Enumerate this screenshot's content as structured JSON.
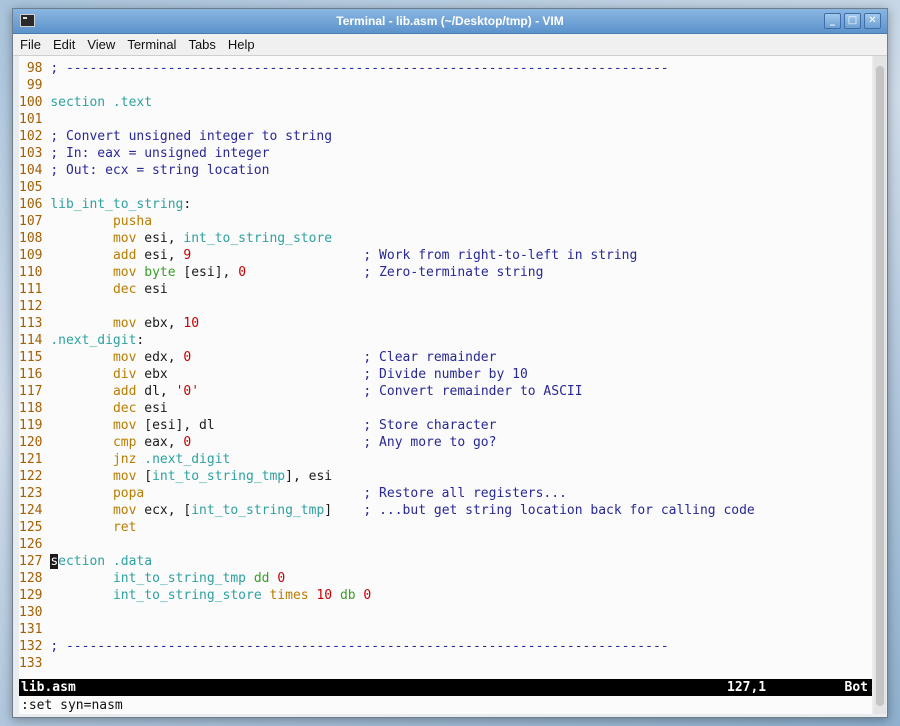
{
  "window": {
    "title": "Terminal - lib.asm (~/Desktop/tmp) - VIM",
    "buttons": {
      "minimize": "_",
      "maximize": "□",
      "close": "✕"
    }
  },
  "menu": [
    "File",
    "Edit",
    "View",
    "Terminal",
    "Tabs",
    "Help"
  ],
  "editor": {
    "lines": [
      [
        [
          "ln",
          " 98 "
        ],
        [
          "cm",
          "; -----------------------------------------------------------------------------"
        ]
      ],
      [
        [
          "ln",
          " 99 "
        ]
      ],
      [
        [
          "ln",
          "100 "
        ],
        [
          "kw",
          "section .text"
        ]
      ],
      [
        [
          "ln",
          "101 "
        ]
      ],
      [
        [
          "ln",
          "102 "
        ],
        [
          "cm",
          "; Convert unsigned integer to string"
        ]
      ],
      [
        [
          "ln",
          "103 "
        ],
        [
          "cm",
          "; In: eax = unsigned integer"
        ]
      ],
      [
        [
          "ln",
          "104 "
        ],
        [
          "cm",
          "; Out: ecx = string location"
        ]
      ],
      [
        [
          "ln",
          "105 "
        ]
      ],
      [
        [
          "ln",
          "106 "
        ],
        [
          "kw",
          "lib_int_to_string"
        ],
        [
          "",
          ":"
        ]
      ],
      [
        [
          "ln",
          "107 "
        ],
        [
          "",
          "        "
        ],
        [
          "ins",
          "pusha"
        ]
      ],
      [
        [
          "ln",
          "108 "
        ],
        [
          "",
          "        "
        ],
        [
          "ins",
          "mov"
        ],
        [
          "",
          " esi, "
        ],
        [
          "kw",
          "int_to_string_store"
        ]
      ],
      [
        [
          "ln",
          "109 "
        ],
        [
          "",
          "        "
        ],
        [
          "ins",
          "add"
        ],
        [
          "",
          " esi, "
        ],
        [
          "num",
          "9"
        ],
        [
          "",
          "                      "
        ],
        [
          "cm",
          "; Work from right-to-left in string"
        ]
      ],
      [
        [
          "ln",
          "110 "
        ],
        [
          "",
          "        "
        ],
        [
          "ins",
          "mov"
        ],
        [
          "",
          " "
        ],
        [
          "ty",
          "byte"
        ],
        [
          "",
          " [esi], "
        ],
        [
          "num",
          "0"
        ],
        [
          "",
          "               "
        ],
        [
          "cm",
          "; Zero-terminate string"
        ]
      ],
      [
        [
          "ln",
          "111 "
        ],
        [
          "",
          "        "
        ],
        [
          "ins",
          "dec"
        ],
        [
          "",
          " esi"
        ]
      ],
      [
        [
          "ln",
          "112 "
        ]
      ],
      [
        [
          "ln",
          "113 "
        ],
        [
          "",
          "        "
        ],
        [
          "ins",
          "mov"
        ],
        [
          "",
          " ebx, "
        ],
        [
          "num",
          "10"
        ]
      ],
      [
        [
          "ln",
          "114 "
        ],
        [
          "kw",
          ".next_digit"
        ],
        [
          "",
          ":"
        ]
      ],
      [
        [
          "ln",
          "115 "
        ],
        [
          "",
          "        "
        ],
        [
          "ins",
          "mov"
        ],
        [
          "",
          " edx, "
        ],
        [
          "num",
          "0"
        ],
        [
          "",
          "                      "
        ],
        [
          "cm",
          "; Clear remainder"
        ]
      ],
      [
        [
          "ln",
          "116 "
        ],
        [
          "",
          "        "
        ],
        [
          "ins",
          "div"
        ],
        [
          "",
          " ebx                         "
        ],
        [
          "cm",
          "; Divide number by 10"
        ]
      ],
      [
        [
          "ln",
          "117 "
        ],
        [
          "",
          "        "
        ],
        [
          "ins",
          "add"
        ],
        [
          "",
          " dl, "
        ],
        [
          "num",
          "'0'"
        ],
        [
          "",
          "                     "
        ],
        [
          "cm",
          "; Convert remainder to ASCII"
        ]
      ],
      [
        [
          "ln",
          "118 "
        ],
        [
          "",
          "        "
        ],
        [
          "ins",
          "dec"
        ],
        [
          "",
          " esi"
        ]
      ],
      [
        [
          "ln",
          "119 "
        ],
        [
          "",
          "        "
        ],
        [
          "ins",
          "mov"
        ],
        [
          "",
          " [esi], dl                   "
        ],
        [
          "cm",
          "; Store character"
        ]
      ],
      [
        [
          "ln",
          "120 "
        ],
        [
          "",
          "        "
        ],
        [
          "ins",
          "cmp"
        ],
        [
          "",
          " eax, "
        ],
        [
          "num",
          "0"
        ],
        [
          "",
          "                      "
        ],
        [
          "cm",
          "; Any more to go?"
        ]
      ],
      [
        [
          "ln",
          "121 "
        ],
        [
          "",
          "        "
        ],
        [
          "ins",
          "jnz"
        ],
        [
          "",
          " "
        ],
        [
          "kw",
          ".next_digit"
        ]
      ],
      [
        [
          "ln",
          "122 "
        ],
        [
          "",
          "        "
        ],
        [
          "ins",
          "mov"
        ],
        [
          "",
          " ["
        ],
        [
          "kw",
          "int_to_string_tmp"
        ],
        [
          "",
          "], esi"
        ]
      ],
      [
        [
          "ln",
          "123 "
        ],
        [
          "",
          "        "
        ],
        [
          "ins",
          "popa"
        ],
        [
          "",
          "                            "
        ],
        [
          "cm",
          "; Restore all registers..."
        ]
      ],
      [
        [
          "ln",
          "124 "
        ],
        [
          "",
          "        "
        ],
        [
          "ins",
          "mov"
        ],
        [
          "",
          " ecx, ["
        ],
        [
          "kw",
          "int_to_string_tmp"
        ],
        [
          "",
          "]    "
        ],
        [
          "cm",
          "; ...but get string location back for calling code"
        ]
      ],
      [
        [
          "ln",
          "125 "
        ],
        [
          "",
          "        "
        ],
        [
          "ins",
          "ret"
        ]
      ],
      [
        [
          "ln",
          "126 "
        ]
      ],
      [
        [
          "ln",
          "127 "
        ],
        [
          "cursor",
          "s"
        ],
        [
          "kw",
          "ection .data"
        ]
      ],
      [
        [
          "ln",
          "128 "
        ],
        [
          "",
          "        "
        ],
        [
          "kw",
          "int_to_string_tmp"
        ],
        [
          "",
          " "
        ],
        [
          "ty",
          "dd"
        ],
        [
          "",
          " "
        ],
        [
          "num",
          "0"
        ]
      ],
      [
        [
          "ln",
          "129 "
        ],
        [
          "",
          "        "
        ],
        [
          "kw",
          "int_to_string_store"
        ],
        [
          "",
          " "
        ],
        [
          "ins",
          "times"
        ],
        [
          "",
          " "
        ],
        [
          "num",
          "10"
        ],
        [
          "",
          " "
        ],
        [
          "ty",
          "db"
        ],
        [
          "",
          " "
        ],
        [
          "num",
          "0"
        ]
      ],
      [
        [
          "ln",
          "130 "
        ]
      ],
      [
        [
          "ln",
          "131 "
        ]
      ],
      [
        [
          "ln",
          "132 "
        ],
        [
          "cm",
          "; -----------------------------------------------------------------------------"
        ]
      ],
      [
        [
          "ln",
          "133 "
        ]
      ]
    ]
  },
  "status": {
    "file": "lib.asm",
    "position": "127,1",
    "scroll": "Bot"
  },
  "command_line": ":set syn=nasm",
  "colors": {
    "line_number": "#a35f00",
    "comment": "#282896",
    "keyword": "#2ea1a1",
    "instruction": "#b87d00",
    "number": "#c80000",
    "type": "#3a9d28"
  }
}
